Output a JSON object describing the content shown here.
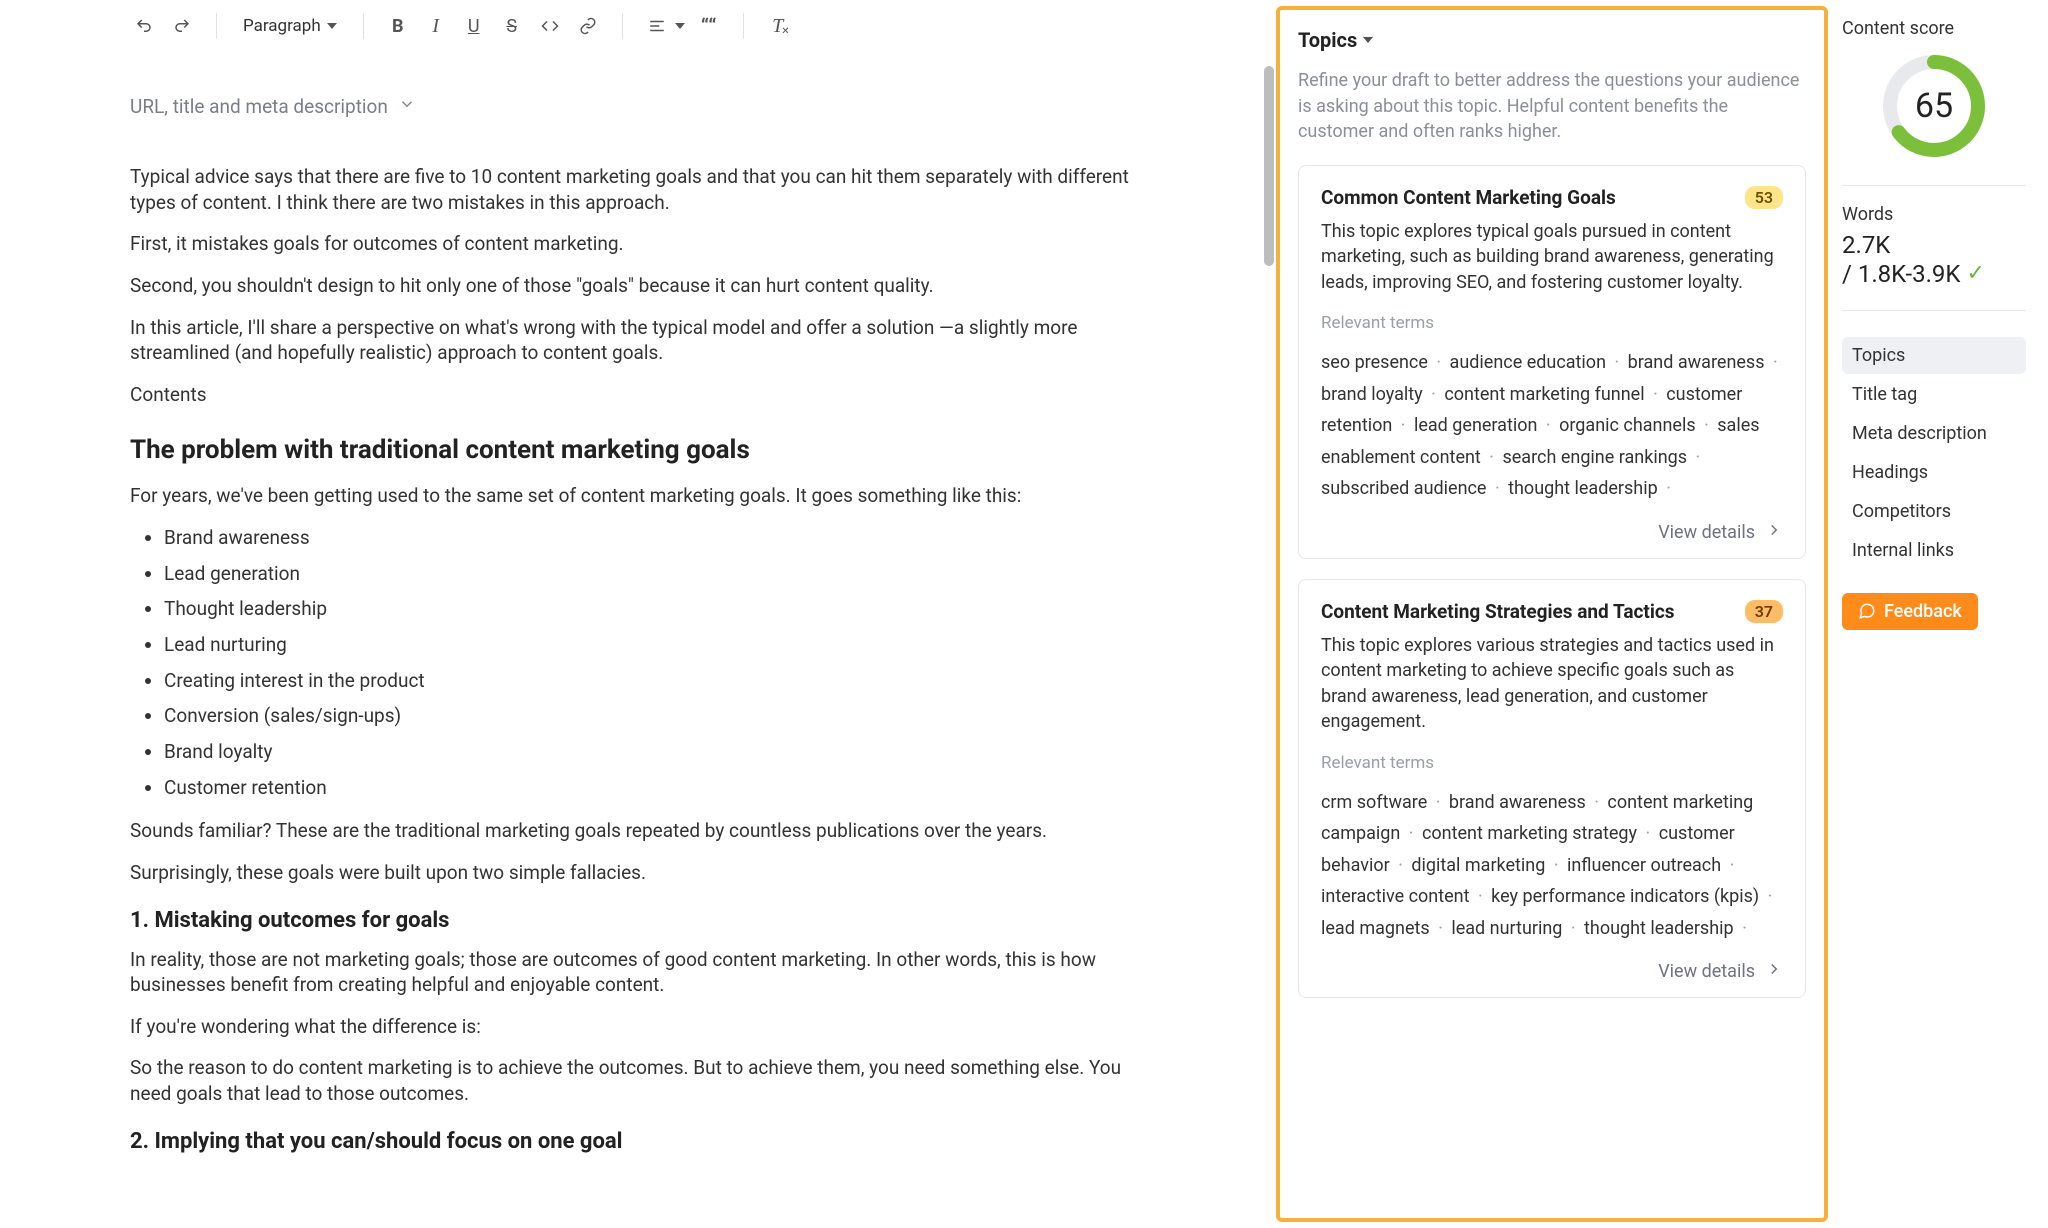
{
  "toolbar": {
    "paragraph_label": "Paragraph"
  },
  "editor": {
    "meta_toggle": "URL, title and meta description",
    "p1": "Typical advice says that there are five to 10 content marketing goals and that you can hit them separately with different types of content. I think there are two mistakes in this approach.",
    "p2": "First, it mistakes goals for outcomes of content marketing.",
    "p3": "Second, you shouldn't design to hit only one of those \"goals\" because it can hurt content quality.",
    "p4": "In this article, I'll share a perspective on what's wrong with the typical model and offer a solution —a slightly more streamlined (and hopefully realistic) approach to content goals.",
    "contents": "Contents",
    "h2a": "The problem with traditional content marketing goals",
    "p5": "For years, we've been getting used to the same set of content marketing goals. It goes something like this:",
    "bullets": [
      "Brand awareness",
      "Lead generation",
      "Thought leadership",
      "Lead nurturing",
      "Creating interest in the product",
      "Conversion (sales/sign-ups)",
      "Brand loyalty",
      "Customer retention"
    ],
    "p6": "Sounds familiar? These are the traditional marketing goals repeated by countless publications over the years.",
    "p7": "Surprisingly, these goals were built upon two simple fallacies.",
    "h3a": "1. Mistaking outcomes for goals",
    "p8": "In reality, those are not marketing goals; those are outcomes of good content marketing. In other words, this is how businesses benefit from creating helpful and enjoyable content.",
    "p9": "If you're wondering what the difference is:",
    "p10": "So the reason to do content marketing is to achieve the outcomes. But to achieve them, you need something else. You need goals that lead to those outcomes.",
    "h3b": "2. Implying that you can/should focus on one goal"
  },
  "topics": {
    "header": "Topics",
    "description": "Refine your draft to better address the questions your audience is asking about this topic. Helpful content benefits the customer and often ranks higher.",
    "cards": [
      {
        "title": "Common Content Marketing Goals",
        "score": "53",
        "badge": "yellow",
        "desc": "This topic explores typical goals pursued in content marketing, such as building brand awareness, generating leads, improving SEO, and fostering customer loyalty.",
        "terms_label": "Relevant terms",
        "terms": [
          "seo presence",
          "audience education",
          "brand awareness",
          "brand loyalty",
          "content marketing funnel",
          "customer retention",
          "lead generation",
          "organic channels",
          "sales enablement content",
          "search engine rankings",
          "subscribed audience",
          "thought leadership"
        ],
        "view": "View details"
      },
      {
        "title": "Content Marketing Strategies and Tactics",
        "score": "37",
        "badge": "orange",
        "desc": "This topic explores various strategies and tactics used in content marketing to achieve specific goals such as brand awareness, lead generation, and customer engagement.",
        "terms_label": "Relevant terms",
        "terms": [
          "crm software",
          "brand awareness",
          "content marketing campaign",
          "content marketing strategy",
          "customer behavior",
          "digital marketing",
          "influencer outreach",
          "interactive content",
          "key performance indicators (kpis)",
          "lead magnets",
          "lead nurturing",
          "thought leadership"
        ],
        "view": "View details"
      }
    ]
  },
  "score": {
    "label": "Content score",
    "value": "65",
    "words_label": "Words",
    "words_value": "2.7K",
    "words_range": "/ 1.8K-3.9K",
    "nav": [
      "Topics",
      "Title tag",
      "Meta description",
      "Headings",
      "Competitors",
      "Internal links"
    ],
    "feedback": "Feedback"
  },
  "chart_data": {
    "type": "pie",
    "title": "Content score",
    "values": [
      65,
      35
    ],
    "categories": [
      "score",
      "remaining"
    ],
    "colors": [
      "#7bbf3a",
      "#e7e9ec"
    ],
    "ylim": [
      0,
      100
    ]
  }
}
